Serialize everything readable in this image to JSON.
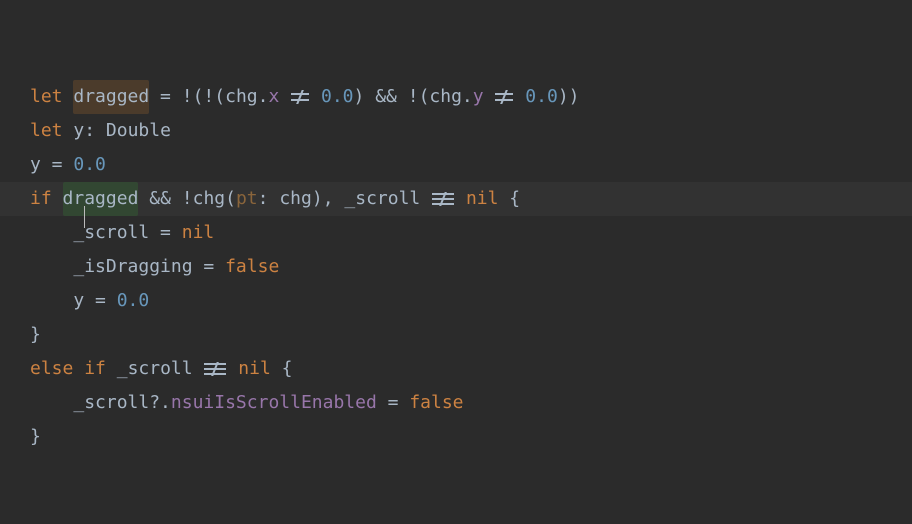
{
  "tokens": {
    "kw_let": "let",
    "kw_if": "if",
    "kw_else": "else",
    "kw_nil": "nil",
    "kw_false": "false",
    "var_dragged": "dragged",
    "var_y": "y",
    "type_Double": "Double",
    "id_chg": "chg",
    "prop_x": "x",
    "prop_y": "y",
    "id_pt": "pt",
    "id__scroll": "_scroll",
    "id__isDragging": "_isDragging",
    "id_nsuiIsScrollEnabled": "nsuiIsScrollEnabled",
    "num_0_0": "0.0",
    "eq": " = ",
    "colon_sp": ": ",
    "comma_sp": ", ",
    "dot": ".",
    "qdot": "?.",
    "amp_amp": " && ",
    "bang": "!",
    "lparen": "(",
    "rparen": ")",
    "lbrace": "{",
    "rbrace": "}",
    "sp": " ",
    "indent": "    "
  },
  "code_text": "let dragged = !(!(chg.x != 0.0) && !(chg.y != 0.0))\nlet y: Double\ny = 0.0\nif dragged && !chg(pt: chg), _scroll !== nil {\n    _scroll = nil\n    _isDragging = false\n    y = 0.0\n}\nelse if _scroll !== nil {\n    _scroll?.nsuiIsScrollEnabled = false\n}",
  "cursor": {
    "line": 3,
    "after_char_index_in_dragged": 2
  },
  "highlighted_identifier": "dragged"
}
